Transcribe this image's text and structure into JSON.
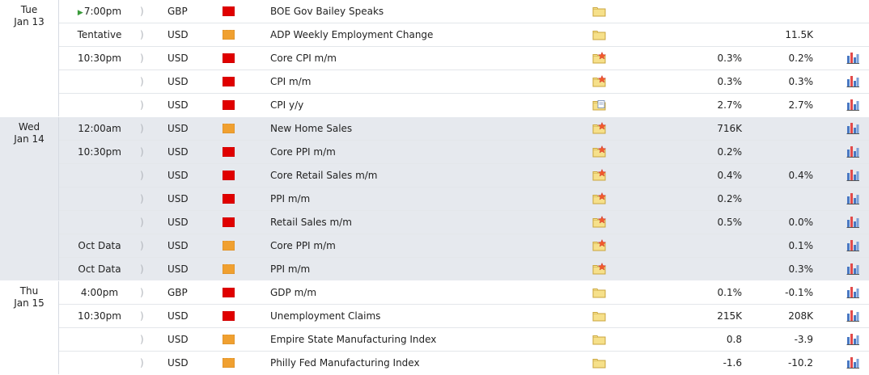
{
  "colors": {
    "high_impact": "#e00000",
    "medium_impact": "#f0a030",
    "shaded_row": "#e6e9ee"
  },
  "icons": {
    "sound": "sound-icon",
    "impact": "impact-flag-icon",
    "folder": "folder-icon",
    "folder_star": "folder-star-icon",
    "folder_doc": "folder-document-icon",
    "chart": "bar-chart-icon"
  },
  "days": [
    {
      "weekday": "Tue",
      "date": "Jan 13",
      "shaded": false,
      "events": [
        {
          "time": "7:00pm",
          "live": true,
          "currency": "GBP",
          "impact": "high",
          "name": "BOE Gov Bailey Speaks",
          "folder": "plain",
          "actual": "",
          "previous": "",
          "chart": false
        },
        {
          "time": "Tentative",
          "currency": "USD",
          "impact": "medium",
          "name": "ADP Weekly Employment Change",
          "folder": "plain",
          "actual": "",
          "previous": "11.5K",
          "chart": false
        },
        {
          "time": "10:30pm",
          "currency": "USD",
          "impact": "high",
          "name": "Core CPI m/m",
          "folder": "star",
          "actual": "0.3%",
          "previous": "0.2%",
          "chart": true
        },
        {
          "time": "",
          "currency": "USD",
          "impact": "high",
          "name": "CPI m/m",
          "folder": "star",
          "actual": "0.3%",
          "previous": "0.3%",
          "chart": true
        },
        {
          "time": "",
          "currency": "USD",
          "impact": "high",
          "name": "CPI y/y",
          "folder": "doc",
          "actual": "2.7%",
          "previous": "2.7%",
          "chart": true
        }
      ]
    },
    {
      "weekday": "Wed",
      "date": "Jan 14",
      "shaded": true,
      "events": [
        {
          "time": "12:00am",
          "currency": "USD",
          "impact": "medium",
          "name": "New Home Sales",
          "folder": "star",
          "actual": "716K",
          "previous": "",
          "chart": true
        },
        {
          "time": "10:30pm",
          "currency": "USD",
          "impact": "high",
          "name": "Core PPI m/m",
          "folder": "star",
          "actual": "0.2%",
          "previous": "",
          "chart": true
        },
        {
          "time": "",
          "currency": "USD",
          "impact": "high",
          "name": "Core Retail Sales m/m",
          "folder": "star",
          "actual": "0.4%",
          "previous": "0.4%",
          "chart": true
        },
        {
          "time": "",
          "currency": "USD",
          "impact": "high",
          "name": "PPI m/m",
          "folder": "star",
          "actual": "0.2%",
          "previous": "",
          "chart": true
        },
        {
          "time": "",
          "currency": "USD",
          "impact": "high",
          "name": "Retail Sales m/m",
          "folder": "star",
          "actual": "0.5%",
          "previous": "0.0%",
          "chart": true
        },
        {
          "time": "Oct Data",
          "currency": "USD",
          "impact": "medium",
          "name": "Core PPI m/m",
          "folder": "star",
          "actual": "",
          "previous": "0.1%",
          "chart": true
        },
        {
          "time": "Oct Data",
          "currency": "USD",
          "impact": "medium",
          "name": "PPI m/m",
          "folder": "star",
          "actual": "",
          "previous": "0.3%",
          "chart": true
        }
      ]
    },
    {
      "weekday": "Thu",
      "date": "Jan 15",
      "shaded": false,
      "events": [
        {
          "time": "4:00pm",
          "currency": "GBP",
          "impact": "high",
          "name": "GDP m/m",
          "folder": "plain",
          "actual": "0.1%",
          "previous": "-0.1%",
          "chart": true
        },
        {
          "time": "10:30pm",
          "currency": "USD",
          "impact": "high",
          "name": "Unemployment Claims",
          "folder": "plain",
          "actual": "215K",
          "previous": "208K",
          "chart": true
        },
        {
          "time": "",
          "currency": "USD",
          "impact": "medium",
          "name": "Empire State Manufacturing Index",
          "folder": "plain",
          "actual": "0.8",
          "previous": "-3.9",
          "chart": true
        },
        {
          "time": "",
          "currency": "USD",
          "impact": "medium",
          "name": "Philly Fed Manufacturing Index",
          "folder": "plain",
          "actual": "-1.6",
          "previous": "-10.2",
          "chart": true
        }
      ]
    }
  ]
}
